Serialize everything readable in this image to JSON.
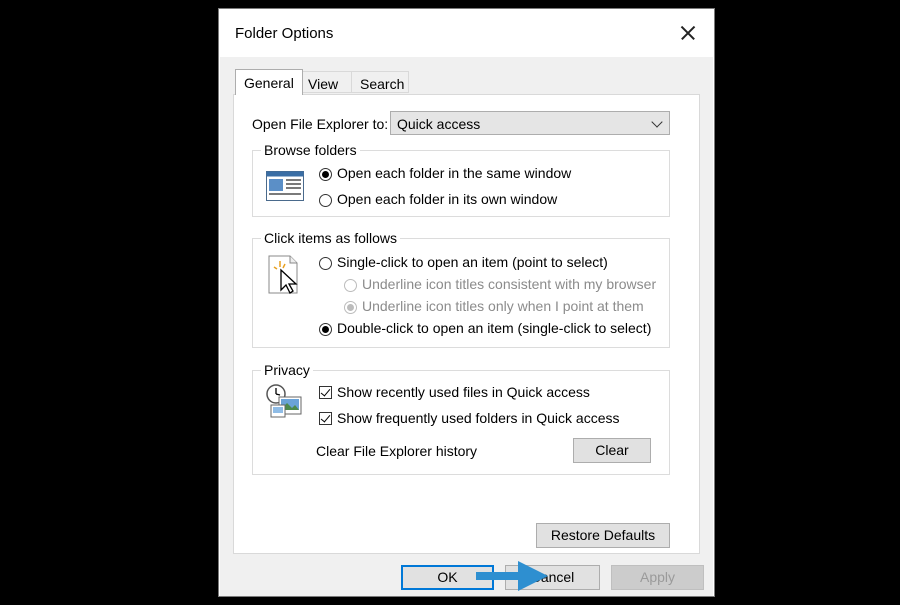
{
  "dialog": {
    "title": "Folder Options"
  },
  "tabs": [
    "General",
    "View",
    "Search"
  ],
  "open_to": {
    "label": "Open File Explorer to:",
    "value": "Quick access"
  },
  "browse": {
    "title": "Browse folders",
    "options": [
      "Open each folder in the same window",
      "Open each folder in its own window"
    ],
    "selected": 0
  },
  "click": {
    "title": "Click items as follows",
    "single": "Single-click to open an item (point to select)",
    "sub_options": [
      "Underline icon titles consistent with my browser",
      "Underline icon titles only when I point at them"
    ],
    "double": "Double-click to open an item (single-click to select)"
  },
  "privacy": {
    "title": "Privacy",
    "checks": [
      "Show recently used files in Quick access",
      "Show frequently used folders in Quick access"
    ],
    "clear_label": "Clear File Explorer history",
    "clear_button": "Clear"
  },
  "restore_button": "Restore Defaults",
  "buttons": {
    "ok": "OK",
    "cancel": "Cancel",
    "apply": "Apply"
  },
  "colors": {
    "accent": "#0078d7",
    "arrow": "#2e8fd0"
  }
}
